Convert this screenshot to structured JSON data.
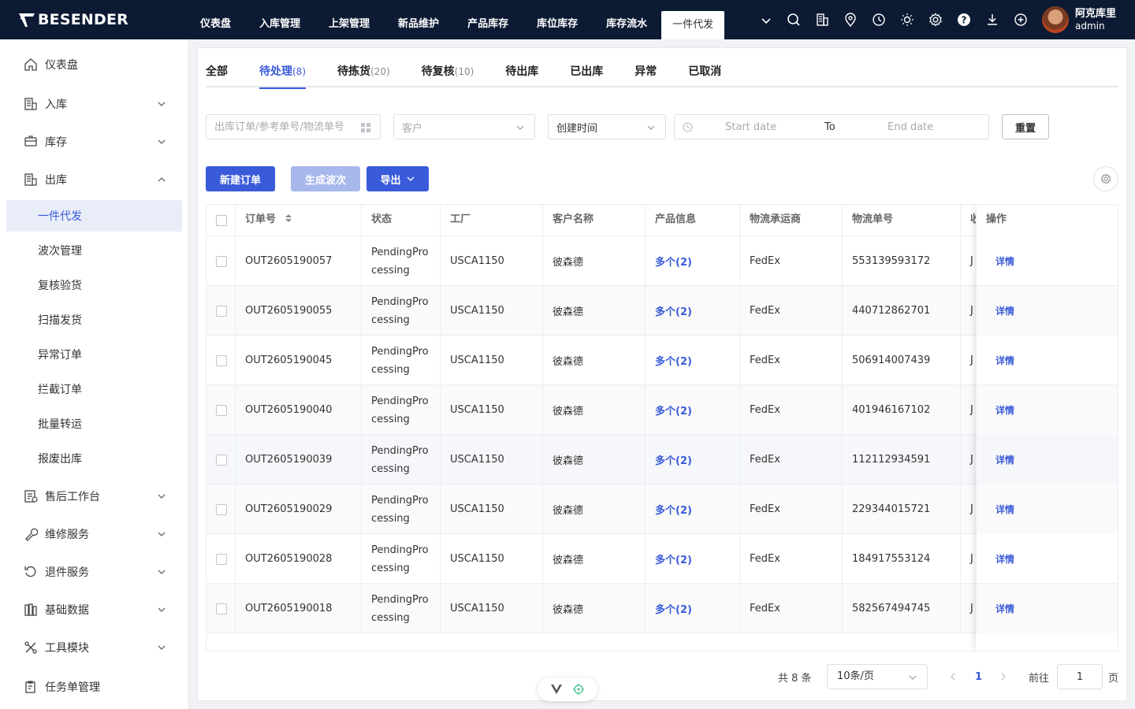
{
  "app": {
    "logo_text": "BESENDER"
  },
  "topnav": {
    "items": [
      {
        "label": "仪表盘"
      },
      {
        "label": "入库管理"
      },
      {
        "label": "上架管理"
      },
      {
        "label": "新品维护"
      },
      {
        "label": "产品库存"
      },
      {
        "label": "库位库存"
      },
      {
        "label": "库存流水"
      },
      {
        "label": "一件代发"
      }
    ],
    "icons": [
      "search-icon",
      "building-icon",
      "location-icon",
      "clock-icon",
      "sun-icon",
      "gear-icon",
      "help-icon",
      "download-icon",
      "add-circle-icon"
    ]
  },
  "user": {
    "name": "阿克库里",
    "role": "admin"
  },
  "sidebar": {
    "menus": [
      {
        "label": "仪表盘",
        "icon": "home-icon"
      },
      {
        "label": "入库",
        "icon": "inbound-icon"
      },
      {
        "label": "库存",
        "icon": "inventory-icon"
      },
      {
        "label": "出库",
        "icon": "outbound-icon"
      }
    ],
    "subs": [
      {
        "label": "一件代发"
      },
      {
        "label": "波次管理"
      },
      {
        "label": "复核验货"
      },
      {
        "label": "扫描发货"
      },
      {
        "label": "异常订单"
      },
      {
        "label": "拦截订单"
      },
      {
        "label": "批量转运"
      },
      {
        "label": "报废出库"
      }
    ],
    "menus2": [
      {
        "label": "售后工作台",
        "icon": "aftersale-icon"
      },
      {
        "label": "维修服务",
        "icon": "wrench-icon"
      },
      {
        "label": "退件服务",
        "icon": "return-icon"
      },
      {
        "label": "基础数据",
        "icon": "database-icon"
      },
      {
        "label": "工具模块",
        "icon": "tools-icon"
      },
      {
        "label": "任务单管理",
        "icon": "task-icon"
      }
    ]
  },
  "tabs": [
    {
      "label": "全部",
      "count": ""
    },
    {
      "label": "待处理",
      "count": "(8)"
    },
    {
      "label": "待拣货",
      "count": "(20)"
    },
    {
      "label": "待复核",
      "count": "(10)"
    },
    {
      "label": "待出库",
      "count": ""
    },
    {
      "label": "已出库",
      "count": ""
    },
    {
      "label": "异常",
      "count": ""
    },
    {
      "label": "已取消",
      "count": ""
    }
  ],
  "filters": {
    "order_placeholder": "出库订单/参考单号/物流单号",
    "customer_placeholder": "客户",
    "time_type": "创建时间",
    "start_placeholder": "Start date",
    "range_sep": "To",
    "end_placeholder": "End date",
    "reset_label": "重置"
  },
  "toolbar": {
    "new_order": "新建订单",
    "gen_wave": "生成波次",
    "export": "导出"
  },
  "table": {
    "columns": [
      "订单号",
      "状态",
      "工厂",
      "客户名称",
      "产品信息",
      "物流承运商",
      "物流单号",
      "收",
      "操作"
    ],
    "rows": [
      {
        "order": "OUT2605190057",
        "status": "PendingProcessing",
        "factory": "USCA1150",
        "customer": "彼森德",
        "product": "多个(2)",
        "carrier": "FedEx",
        "tracking": "553139593172",
        "recv": "J",
        "action": "详情"
      },
      {
        "order": "OUT2605190055",
        "status": "PendingProcessing",
        "factory": "USCA1150",
        "customer": "彼森德",
        "product": "多个(2)",
        "carrier": "FedEx",
        "tracking": "440712862701",
        "recv": "J",
        "action": "详情"
      },
      {
        "order": "OUT2605190045",
        "status": "PendingProcessing",
        "factory": "USCA1150",
        "customer": "彼森德",
        "product": "多个(2)",
        "carrier": "FedEx",
        "tracking": "506914007439",
        "recv": "J",
        "action": "详情"
      },
      {
        "order": "OUT2605190040",
        "status": "PendingProcessing",
        "factory": "USCA1150",
        "customer": "彼森德",
        "product": "多个(2)",
        "carrier": "FedEx",
        "tracking": "401946167102",
        "recv": "J",
        "action": "详情"
      },
      {
        "order": "OUT2605190039",
        "status": "PendingProcessing",
        "factory": "USCA1150",
        "customer": "彼森德",
        "product": "多个(2)",
        "carrier": "FedEx",
        "tracking": "112112934591",
        "recv": "J",
        "action": "详情"
      },
      {
        "order": "OUT2605190029",
        "status": "PendingProcessing",
        "factory": "USCA1150",
        "customer": "彼森德",
        "product": "多个(2)",
        "carrier": "FedEx",
        "tracking": "229344015721",
        "recv": "J",
        "action": "详情"
      },
      {
        "order": "OUT2605190028",
        "status": "PendingProcessing",
        "factory": "USCA1150",
        "customer": "彼森德",
        "product": "多个(2)",
        "carrier": "FedEx",
        "tracking": "184917553124",
        "recv": "J",
        "action": "详情"
      },
      {
        "order": "OUT2605190018",
        "status": "PendingProcessing",
        "factory": "USCA1150",
        "customer": "彼森德",
        "product": "多个(2)",
        "carrier": "FedEx",
        "tracking": "582567494745",
        "recv": "J",
        "action": "详情"
      }
    ]
  },
  "pagination": {
    "total": "共 8 条",
    "page_size": "10条/页",
    "current": "1",
    "goto_label": "前往",
    "goto_value": "1",
    "page_unit": "页"
  },
  "colors": {
    "primary": "#3a5bd9",
    "topbar": "#0c1a33",
    "disabled": "#a8b8ec"
  }
}
